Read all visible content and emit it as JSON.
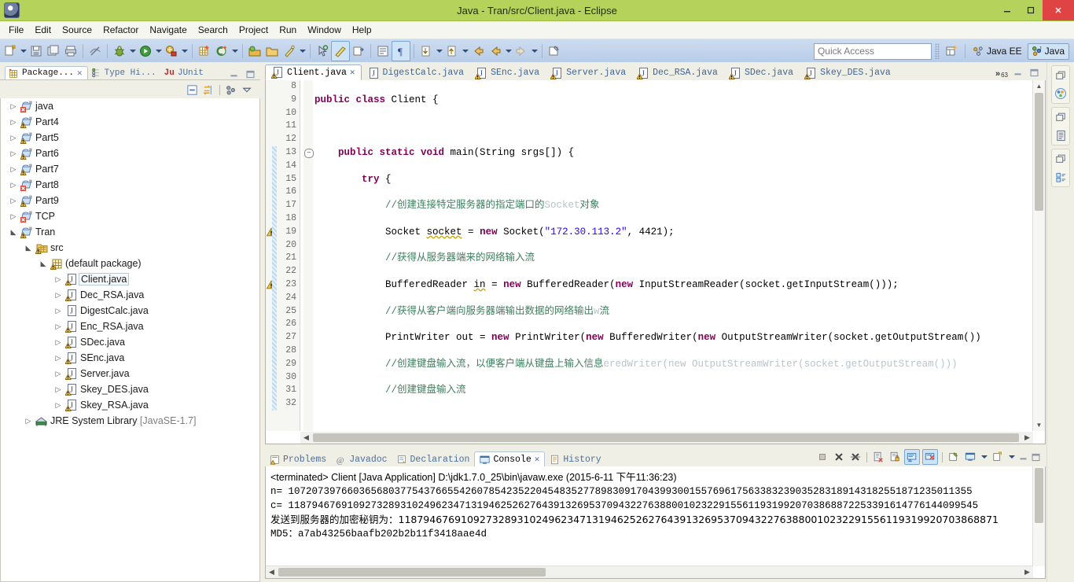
{
  "window": {
    "title": "Java - Tran/src/Client.java - Eclipse",
    "app_icon": "eclipse-icon",
    "minimize_label": "–",
    "maximize_label": "❐",
    "close_label": "✕",
    "titlebar_color": "#b5d35a"
  },
  "menubar": {
    "items": [
      "File",
      "Edit",
      "Source",
      "Refactor",
      "Navigate",
      "Search",
      "Project",
      "Run",
      "Window",
      "Help"
    ]
  },
  "toolbar": {
    "quick_access_placeholder": "Quick Access",
    "quick_access_value": "",
    "perspectives": [
      {
        "label": "Java EE",
        "active": false
      },
      {
        "label": "Java",
        "active": true
      }
    ],
    "open_perspective_tooltip": "Open Perspective"
  },
  "package_explorer": {
    "tabs": [
      {
        "label": "Package...",
        "icon": "package-explorer-icon",
        "active": true,
        "closable": true
      },
      {
        "label": "Type Hi...",
        "icon": "type-hierarchy-icon",
        "active": false,
        "closable": false
      },
      {
        "label": "JUnit",
        "icon": "junit-icon",
        "active": false,
        "closable": false
      }
    ],
    "view_toolbar": [
      "collapse-all-icon",
      "link-with-editor-icon",
      "focus-icon",
      "view-menu-icon"
    ],
    "tree": [
      {
        "label": "java",
        "depth": 0,
        "type": "project",
        "expanded": false,
        "warning": false,
        "error": true
      },
      {
        "label": "Part4",
        "depth": 0,
        "type": "project",
        "expanded": false,
        "warning": true
      },
      {
        "label": "Part5",
        "depth": 0,
        "type": "project",
        "expanded": false,
        "warning": true
      },
      {
        "label": "Part6",
        "depth": 0,
        "type": "project",
        "expanded": false,
        "warning": true
      },
      {
        "label": "Part7",
        "depth": 0,
        "type": "project",
        "expanded": false,
        "warning": true
      },
      {
        "label": "Part8",
        "depth": 0,
        "type": "project",
        "expanded": false,
        "error": true
      },
      {
        "label": "Part9",
        "depth": 0,
        "type": "project",
        "expanded": false,
        "warning": true
      },
      {
        "label": "TCP",
        "depth": 0,
        "type": "project",
        "expanded": false,
        "error": true
      },
      {
        "label": "Tran",
        "depth": 0,
        "type": "project",
        "expanded": true,
        "warning": true
      },
      {
        "label": "src",
        "depth": 1,
        "type": "source-folder",
        "expanded": true,
        "warning": true
      },
      {
        "label": "(default package)",
        "depth": 2,
        "type": "package",
        "expanded": true,
        "warning": true
      },
      {
        "label": "Client.java",
        "depth": 3,
        "type": "java-file",
        "expanded": false,
        "warning": true,
        "selected": true
      },
      {
        "label": "Dec_RSA.java",
        "depth": 3,
        "type": "java-file",
        "expanded": false,
        "warning": true
      },
      {
        "label": "DigestCalc.java",
        "depth": 3,
        "type": "java-file",
        "expanded": false,
        "warning": false
      },
      {
        "label": "Enc_RSA.java",
        "depth": 3,
        "type": "java-file",
        "expanded": false,
        "warning": true
      },
      {
        "label": "SDec.java",
        "depth": 3,
        "type": "java-file",
        "expanded": false,
        "warning": true
      },
      {
        "label": "SEnc.java",
        "depth": 3,
        "type": "java-file",
        "expanded": false,
        "warning": true
      },
      {
        "label": "Server.java",
        "depth": 3,
        "type": "java-file",
        "expanded": false,
        "warning": true
      },
      {
        "label": "Skey_DES.java",
        "depth": 3,
        "type": "java-file",
        "expanded": false,
        "warning": true
      },
      {
        "label": "Skey_RSA.java",
        "depth": 3,
        "type": "java-file",
        "expanded": false,
        "warning": true
      },
      {
        "label": "JRE System Library",
        "suffix": "[JavaSE-1.7]",
        "depth": 1,
        "type": "library",
        "expanded": false
      }
    ]
  },
  "editor": {
    "tabs": [
      {
        "label": "Client.java",
        "active": true,
        "warning": true,
        "closable": true
      },
      {
        "label": "DigestCalc.java",
        "active": false,
        "warning": false
      },
      {
        "label": "SEnc.java",
        "active": false,
        "warning": true
      },
      {
        "label": "Server.java",
        "active": false,
        "warning": true
      },
      {
        "label": "Dec_RSA.java",
        "active": false,
        "warning": true
      },
      {
        "label": "SDec.java",
        "active": false,
        "warning": true
      },
      {
        "label": "Skey_DES.java",
        "active": false,
        "warning": true
      }
    ],
    "overflow_indicator": "»",
    "overflow_count": "63",
    "first_line_number": 8,
    "lines": [
      {
        "n": 8,
        "html": ""
      },
      {
        "n": 9,
        "html": "<span class=\"kw\">public class</span> Client {"
      },
      {
        "n": 10,
        "html": ""
      },
      {
        "n": 11,
        "html": ""
      },
      {
        "n": 12,
        "html": ""
      },
      {
        "n": 13,
        "html": "    <span class=\"kw\">public static void</span> main(String srgs[]) {",
        "fold": true,
        "changed": true
      },
      {
        "n": 14,
        "html": "",
        "changed": true
      },
      {
        "n": 15,
        "html": "        <span class=\"kw\">try</span> {",
        "changed": true
      },
      {
        "n": 16,
        "html": "",
        "changed": true
      },
      {
        "n": 17,
        "html": "            <span class=\"cmt\">//创建连接特定服务器的指定端口的</span><span class=\"cmt-gray\">Socket</span><span class=\"cmt\">对象</span>",
        "changed": true
      },
      {
        "n": 18,
        "html": "",
        "changed": true
      },
      {
        "n": 19,
        "html": "            Socket <span class=\"undl\">socket</span> = <span class=\"kw\">new</span> Socket(<span class=\"str\">\"172.30.113.2\"</span>, 4421);",
        "changed": true,
        "marker": "warning"
      },
      {
        "n": 20,
        "html": "",
        "changed": true
      },
      {
        "n": 21,
        "html": "            <span class=\"cmt\">//获得从服务器端来的网络输入流</span>",
        "changed": true
      },
      {
        "n": 22,
        "html": "",
        "changed": true
      },
      {
        "n": 23,
        "html": "            BufferedReader <span class=\"undl\">in</span> = <span class=\"kw\">new</span> BufferedReader(<span class=\"kw\">new</span> InputStreamReader(socket.getInputStream()));",
        "changed": true,
        "marker": "warning"
      },
      {
        "n": 24,
        "html": "",
        "changed": true
      },
      {
        "n": 25,
        "html": "            <span class=\"cmt\">//获得从客户端向服务器端输出数据的网络输出</span><span class=\"cmt-gray\">w</span><span class=\"cmt\">流</span>",
        "changed": true
      },
      {
        "n": 26,
        "html": "",
        "changed": true
      },
      {
        "n": 27,
        "html": "            PrintWriter out = <span class=\"kw\">new</span> PrintWriter(<span class=\"kw\">new</span> BufferedWriter(<span class=\"kw\">new</span> OutputStreamWriter(socket.getOutputStream())",
        "changed": true
      },
      {
        "n": 28,
        "html": "",
        "changed": true
      },
      {
        "n": 29,
        "html": "            <span class=\"cmt\">//创建键盘输入流，以便客户端从键盘上输入信息</span><span class=\"cmt-gray\">eredWriter(new OutputStreamWriter(socket.getOutputStream()))</span>",
        "changed": true
      },
      {
        "n": 30,
        "html": "",
        "changed": true
      },
      {
        "n": 31,
        "html": "            <span class=\"cmt\">//创建键盘输入流</span>",
        "changed": true
      },
      {
        "n": 32,
        "html": "",
        "changed": true
      }
    ]
  },
  "console": {
    "tabs": [
      {
        "label": "Problems",
        "icon": "problems-icon",
        "active": false
      },
      {
        "label": "Javadoc",
        "icon": "javadoc-icon",
        "active": false
      },
      {
        "label": "Declaration",
        "icon": "declaration-icon",
        "active": false
      },
      {
        "label": "Console",
        "icon": "console-icon",
        "active": true,
        "closable": true
      },
      {
        "label": "History",
        "icon": "history-icon",
        "active": false
      }
    ],
    "toolbar_icons": [
      "terminate-icon",
      "remove-launch-icon",
      "remove-all-terminated-icon",
      "clear-console-icon",
      "scroll-lock-icon",
      "show-console-on-output-icon",
      "show-console-on-error-icon",
      "pin-console-icon",
      "display-console-icon",
      "display-console-dropdown-icon",
      "open-console-icon",
      "open-console-dropdown-icon",
      "minimize-icon",
      "maximize-icon"
    ],
    "header": "<terminated> Client [Java Application] D:\\jdk1.7.0_25\\bin\\javaw.exe (2015-6-11 下午11:36:23)",
    "output": [
      "n= 10720739766036568037754376655426078542352204548352778983091704399300155769617563383239035283189143182551871235011355",
      "c= 118794676910927328931024962347131946252627643913269537094322763880010232291556119319920703868872253391614776144099545",
      "发送到服务器的加密秘钥为：118794676910927328931024962347131946252627643913269537094322763880010232291556119319920703868871",
      "MD5：a7ab43256baafb202b2b11f3418aae4d"
    ]
  },
  "right_strip": {
    "groups": [
      [
        "restore-icon",
        "package-explorer-mini-icon"
      ],
      [
        "restore-icon",
        "outline-mini-icon"
      ],
      [
        "restore-icon",
        "task-list-mini-icon"
      ]
    ]
  }
}
